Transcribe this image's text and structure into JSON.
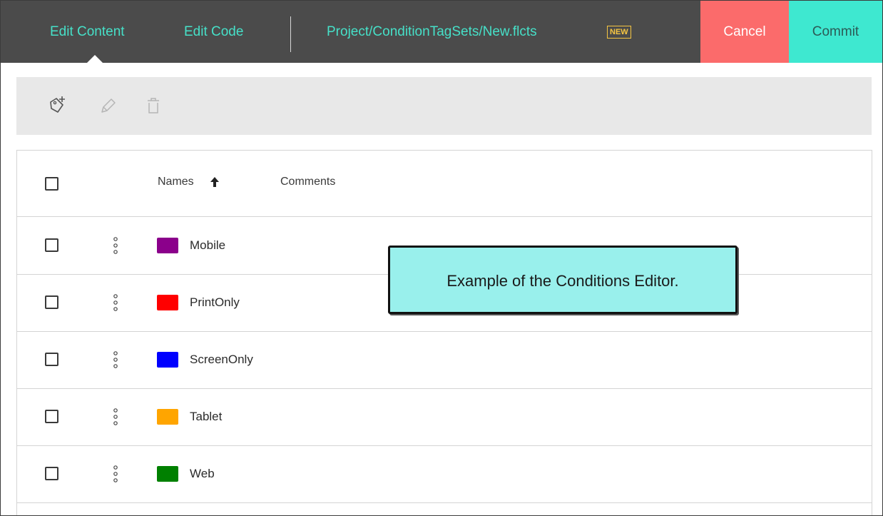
{
  "header": {
    "tabs": [
      {
        "label": "Edit Content",
        "active": true
      },
      {
        "label": "Edit Code",
        "active": false
      }
    ],
    "file_path": "Project/ConditionTagSets/New.flcts",
    "new_badge": "NEW",
    "cancel_label": "Cancel",
    "commit_label": "Commit",
    "accent_color": "#46e0c8",
    "cancel_color": "#fb6b6b",
    "commit_color": "#3ee8d0"
  },
  "toolbar": {
    "tools": [
      {
        "icon": "add-tag-icon"
      },
      {
        "icon": "pencil-icon"
      },
      {
        "icon": "trash-icon"
      }
    ]
  },
  "table": {
    "columns": {
      "names": "Names",
      "comments": "Comments"
    },
    "sort": "ascending",
    "rows": [
      {
        "name": "Mobile",
        "color": "#8b008b"
      },
      {
        "name": "PrintOnly",
        "color": "#ff0000"
      },
      {
        "name": "ScreenOnly",
        "color": "#0000ff"
      },
      {
        "name": "Tablet",
        "color": "#ffa500"
      },
      {
        "name": "Web",
        "color": "#008000"
      }
    ]
  },
  "callout": {
    "text": "Example of the Conditions Editor.",
    "background": "#99f0ec"
  }
}
